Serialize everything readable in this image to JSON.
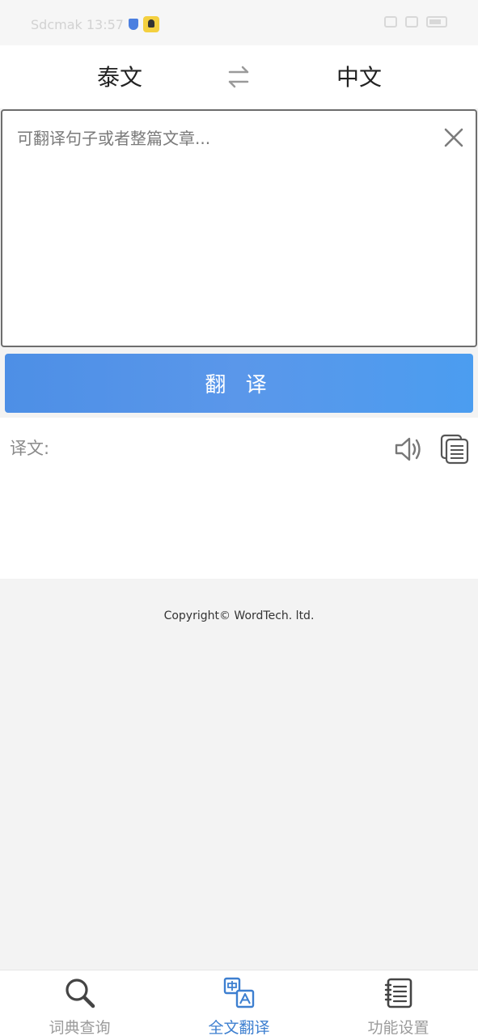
{
  "status_bar": {
    "left_text": "Sdcmak 13:57",
    "right_text": ""
  },
  "header": {
    "source_language": "泰文",
    "target_language": "中文"
  },
  "input": {
    "placeholder": "可翻译句子或者整篇文章...",
    "value": ""
  },
  "translate_button": {
    "label": "翻 译"
  },
  "result": {
    "label": "译文:",
    "text": ""
  },
  "footer": {
    "copyright": "Copyright© WordTech. ltd."
  },
  "bottom_nav": {
    "items": [
      {
        "label": "词典查询",
        "icon": "search-icon",
        "active": false
      },
      {
        "label": "全文翻译",
        "icon": "translate-icon",
        "active": true
      },
      {
        "label": "功能设置",
        "icon": "notebook-icon",
        "active": false
      }
    ]
  },
  "colors": {
    "accent": "#4a90e2",
    "active_nav": "#3d7fd0",
    "background": "#f3f3f3"
  }
}
